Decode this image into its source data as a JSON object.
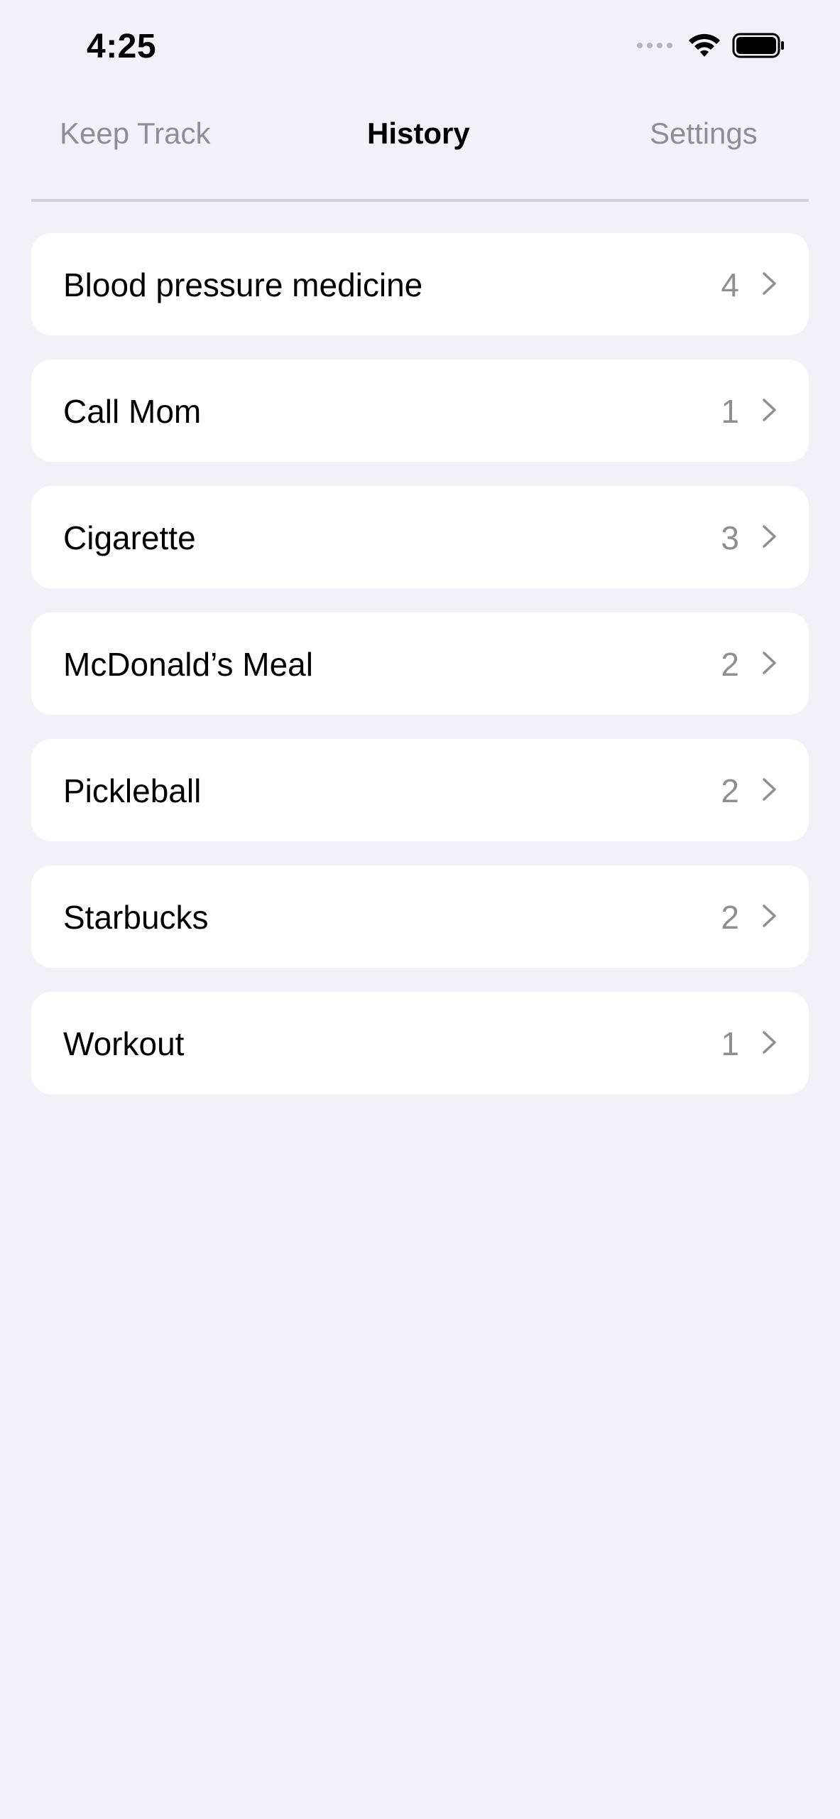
{
  "status_bar": {
    "time": "4:25",
    "icons": [
      "signal-dots-icon",
      "wifi-icon",
      "battery-icon"
    ]
  },
  "nav": {
    "tabs": [
      {
        "label": "Keep Track",
        "active": false
      },
      {
        "label": "History",
        "active": true
      },
      {
        "label": "Settings",
        "active": false
      }
    ]
  },
  "history": {
    "items": [
      {
        "label": "Blood pressure medicine",
        "count": "4"
      },
      {
        "label": "Call Mom",
        "count": "1"
      },
      {
        "label": "Cigarette",
        "count": "3"
      },
      {
        "label": "McDonald’s Meal",
        "count": "2"
      },
      {
        "label": "Pickleball",
        "count": "2"
      },
      {
        "label": "Starbucks",
        "count": "2"
      },
      {
        "label": "Workout",
        "count": "1"
      }
    ]
  },
  "colors": {
    "background": "#f1f1f7",
    "card": "#ffffff",
    "secondary_text": "#8e8e93",
    "divider": "#d1d1d6"
  }
}
